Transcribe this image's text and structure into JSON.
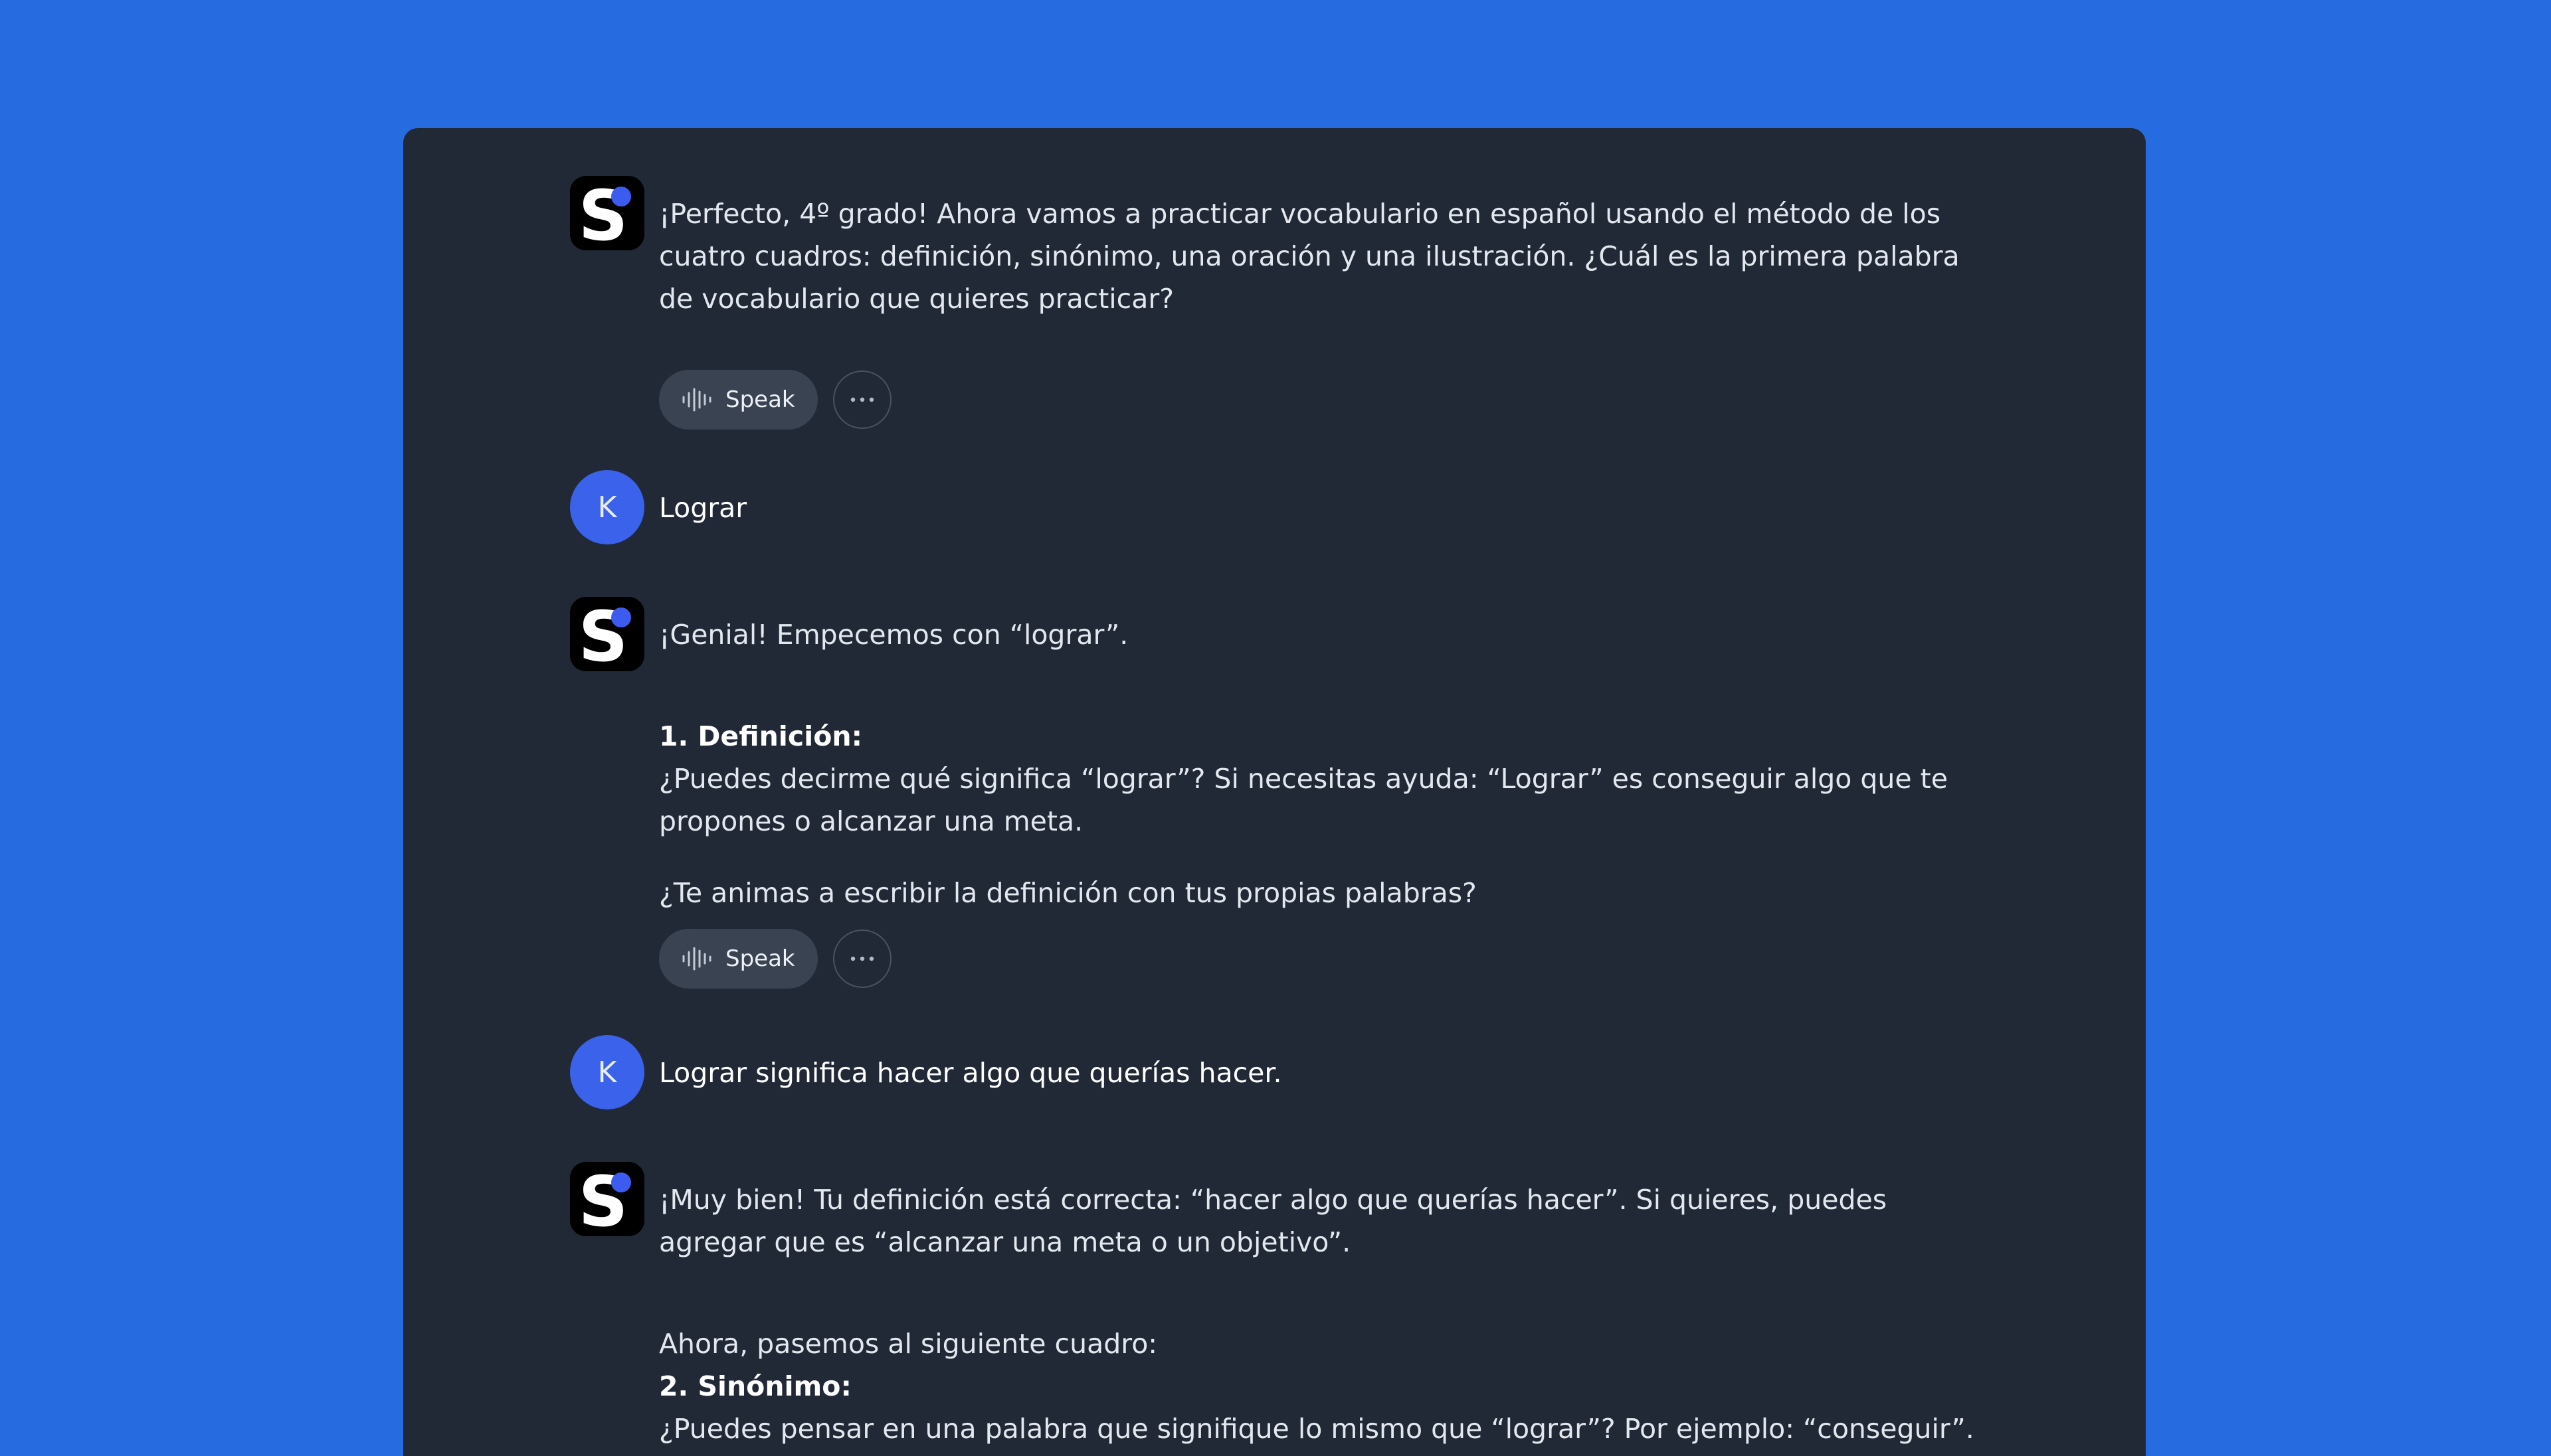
{
  "colors": {
    "background": "#266be0",
    "panel": "#212936",
    "user_avatar": "#3a62ea",
    "bot_badge_dot": "#3c5cf0",
    "button": "#3a4352"
  },
  "icons": {
    "bot_avatar": "logo-icon",
    "speak": "waveform-icon",
    "more": "more-dots-icon"
  },
  "user": {
    "initial": "K"
  },
  "messages": [
    {
      "role": "assistant",
      "text": "¡Perfecto, 4º grado! Ahora vamos a practicar vocabulario en español usando el método de los cuatro cuadros: definición, sinónimo, una oración y una ilustración. ¿Cuál es la primera palabra de vocabulario que quieres practicar?",
      "speak_label": "Speak"
    },
    {
      "role": "user",
      "text": "Lograr"
    },
    {
      "role": "assistant",
      "intro": "¡Genial! Empecemos con “lograr”.",
      "heading": "1. Definición:",
      "body": "¿Puedes decirme qué significa “lograr”? Si necesitas ayuda: “Lograr” es conseguir algo que te propones o alcanzar una meta.",
      "question": "¿Te animas a escribir la definición con tus propias palabras?",
      "speak_label": "Speak"
    },
    {
      "role": "user",
      "text": "Lograr significa hacer algo que querías hacer."
    },
    {
      "role": "assistant",
      "intro": "¡Muy bien! Tu definición está correcta: “hacer algo que querías hacer”. Si quieres, puedes agregar que es “alcanzar una meta o un objetivo”.",
      "transition": "Ahora, pasemos al siguiente cuadro:",
      "heading": "2. Sinónimo:",
      "body": "¿Puedes pensar en una palabra que signifique lo mismo que “lograr”? Por ejemplo: “conseguir”. ¿Se te"
    }
  ]
}
